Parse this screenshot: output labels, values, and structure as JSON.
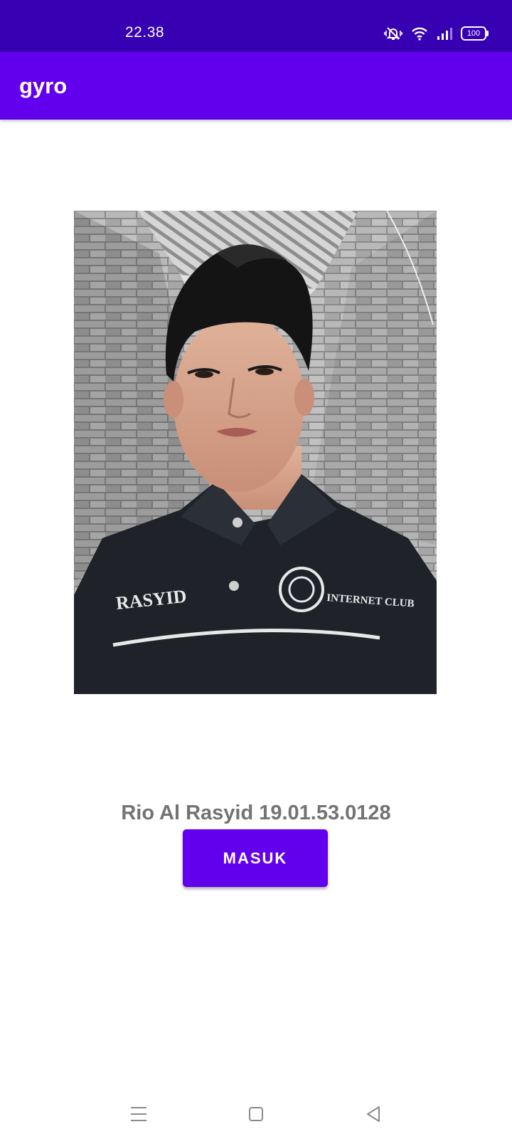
{
  "status_bar": {
    "time": "22.38",
    "battery": "100",
    "icons": [
      "vibrate-mute-icon",
      "wifi-icon",
      "signal-icon",
      "battery-icon"
    ],
    "background": "#3700b3"
  },
  "app_bar": {
    "title": "gyro",
    "background": "#6200ee"
  },
  "content": {
    "photo_alt": "profile-photo",
    "name": "Rio Al Rasyid 19.01.53.0128",
    "name_color": "#737373",
    "button_label": "MASUK",
    "button_color": "#6200ee",
    "jacket_text_left": "RASYID",
    "jacket_text_right": "INTERNET CLUB"
  },
  "nav_bar": {
    "icons": [
      "menu-icon",
      "home-icon",
      "back-icon"
    ]
  }
}
